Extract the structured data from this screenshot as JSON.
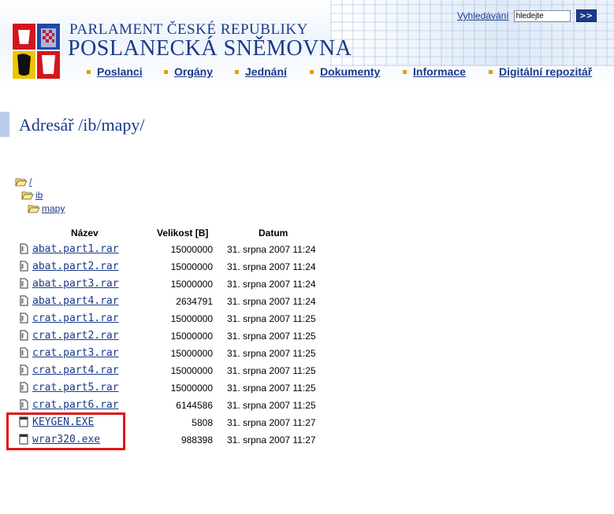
{
  "header": {
    "title_line1": "PARLAMENT ČESKÉ REPUBLIKY",
    "title_line2": "POSLANECKÁ SNĚMOVNA",
    "search_label": "Vyhledávání",
    "search_value": "hledejte",
    "search_button": ">>",
    "nav": [
      "Poslanci",
      "Orgány",
      "Jednání",
      "Dokumenty",
      "Informace",
      "Digitální repozitář"
    ]
  },
  "page": {
    "title": "Adresář /ib/mapy/"
  },
  "tree": [
    "/",
    "ib",
    "mapy"
  ],
  "table": {
    "headers": [
      "Název",
      "Velikost [B]",
      "Datum"
    ],
    "rows": [
      {
        "name": "abat.part1.rar",
        "size": "15000000",
        "date": "31. srpna 2007 11:24",
        "icon": "archive-file-icon"
      },
      {
        "name": "abat.part2.rar",
        "size": "15000000",
        "date": "31. srpna 2007 11:24",
        "icon": "archive-file-icon"
      },
      {
        "name": "abat.part3.rar",
        "size": "15000000",
        "date": "31. srpna 2007 11:24",
        "icon": "archive-file-icon"
      },
      {
        "name": "abat.part4.rar",
        "size": "2634791",
        "date": "31. srpna 2007 11:24",
        "icon": "archive-file-icon"
      },
      {
        "name": "crat.part1.rar",
        "size": "15000000",
        "date": "31. srpna 2007 11:25",
        "icon": "archive-file-icon"
      },
      {
        "name": "crat.part2.rar",
        "size": "15000000",
        "date": "31. srpna 2007 11:25",
        "icon": "archive-file-icon"
      },
      {
        "name": "crat.part3.rar",
        "size": "15000000",
        "date": "31. srpna 2007 11:25",
        "icon": "archive-file-icon"
      },
      {
        "name": "crat.part4.rar",
        "size": "15000000",
        "date": "31. srpna 2007 11:25",
        "icon": "archive-file-icon"
      },
      {
        "name": "crat.part5.rar",
        "size": "15000000",
        "date": "31. srpna 2007 11:25",
        "icon": "archive-file-icon"
      },
      {
        "name": "crat.part6.rar",
        "size": "6144586",
        "date": "31. srpna 2007 11:25",
        "icon": "archive-file-icon"
      },
      {
        "name": "KEYGEN.EXE",
        "size": "5808",
        "date": "31. srpna 2007 11:27",
        "icon": "executable-file-icon"
      },
      {
        "name": "wrar320.exe",
        "size": "988398",
        "date": "31. srpna 2007 11:27",
        "icon": "executable-file-icon"
      }
    ]
  },
  "colors": {
    "brand": "#1a3a8a",
    "highlight": "#e01515",
    "bullet": "#e0a000"
  }
}
